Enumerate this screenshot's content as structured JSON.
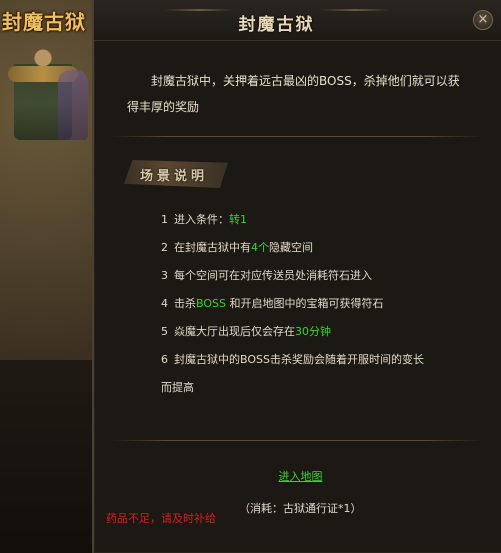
{
  "region": {
    "title": "封魔古狱"
  },
  "dialog": {
    "title": "封魔古狱",
    "close": "×",
    "intro": "封魔古狱中，关押着远古最凶的BOSS，杀掉他们就可以获得丰厚的奖励",
    "section_label": "场景说明",
    "rules": [
      {
        "num": "1",
        "parts": [
          "进入条件：",
          "转1"
        ]
      },
      {
        "num": "2",
        "parts": [
          "在封魔古狱中有",
          "4个",
          "隐藏空间"
        ]
      },
      {
        "num": "3",
        "parts": [
          "每个空间可在对应传送员处消耗符石进入"
        ]
      },
      {
        "num": "4",
        "parts": [
          "击杀",
          "BOSS",
          " 和开启地图中的宝箱可获得符石"
        ]
      },
      {
        "num": "5",
        "parts": [
          "焱魔大厅出现后仅会存在",
          "30分钟"
        ]
      },
      {
        "num": "6",
        "parts": [
          "封魔古狱中的BOSS击杀奖励会随着开服时间的变长"
        ]
      }
    ],
    "rule6_cont": "而提高",
    "enter_link": "进入地图",
    "cost": "（消耗：古狱通行证*1）",
    "warning": "药品不足，请及时补给"
  },
  "colors": {
    "highlight": "#3ad42e",
    "warning": "#d02020",
    "text": "#e0d8c8"
  },
  "icons": {
    "close": "close-icon"
  }
}
